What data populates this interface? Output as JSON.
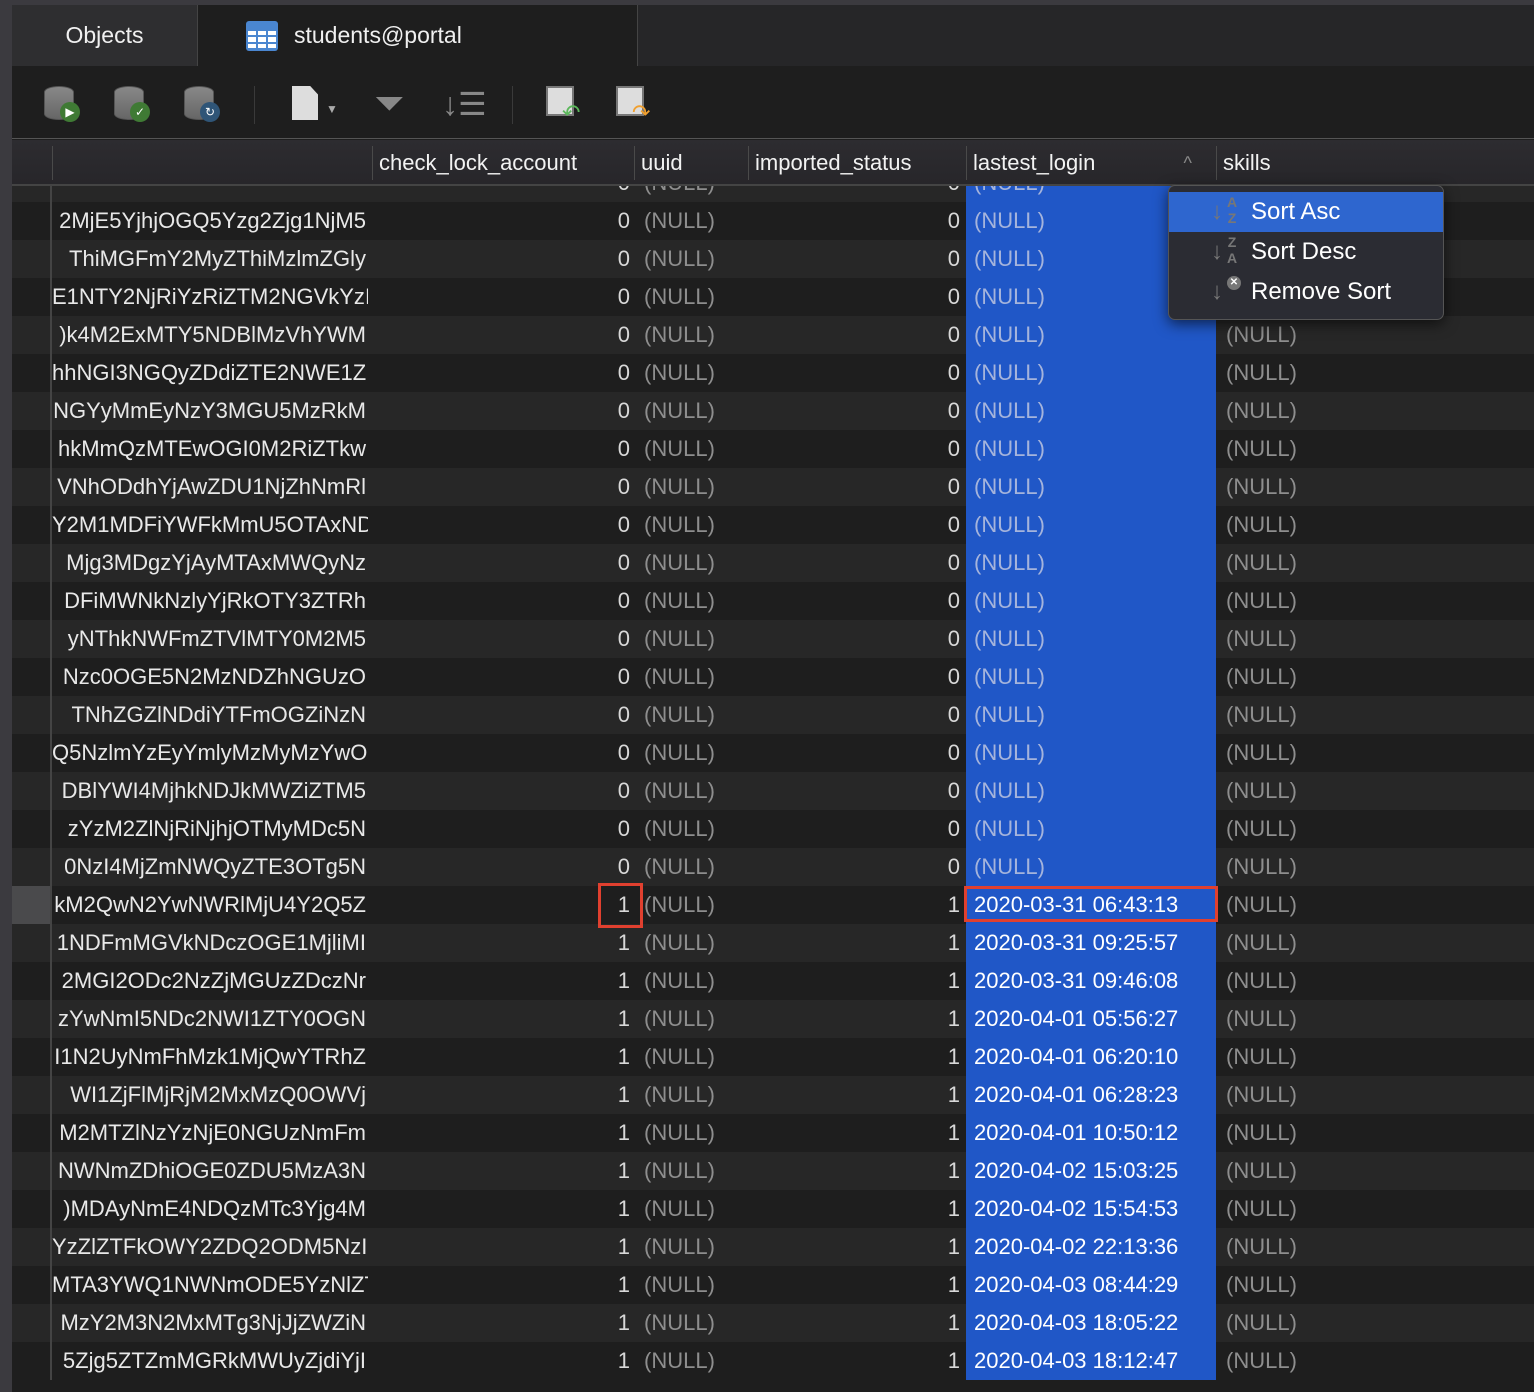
{
  "tabs": [
    {
      "label": "Objects"
    },
    {
      "label": "students@portal",
      "icon": "table-icon"
    }
  ],
  "toolbar": {
    "icons": [
      "db-run-icon",
      "db-commit-icon",
      "db-refresh-icon",
      "document-menu-icon",
      "filter-icon",
      "sort-icon",
      "import-icon",
      "export-icon"
    ]
  },
  "columns": {
    "check_lock_account": "check_lock_account",
    "uuid": "uuid",
    "imported_status": "imported_status",
    "lastest_login": "lastest_login",
    "skills": "skills"
  },
  "context_menu": {
    "items": [
      {
        "label": "Sort Asc",
        "icon": "sort-asc-icon",
        "active": true
      },
      {
        "label": "Sort Desc",
        "icon": "sort-desc-icon"
      },
      {
        "label": "Remove Sort",
        "icon": "remove-sort-icon"
      }
    ]
  },
  "colors": {
    "selected_column": "#2057c7",
    "highlight_box": "#e0402f",
    "menu_active": "#2e66cf"
  },
  "rows": [
    {
      "id": "",
      "lock": "0",
      "uuid": "(NULL)",
      "imp": "0",
      "login": "(NULL)",
      "skills": ""
    },
    {
      "id": "2MjE5YjhjOGQ5Yzg2Zjg1NjM5",
      "lock": "0",
      "uuid": "(NULL)",
      "imp": "0",
      "login": "(NULL)",
      "skills": ""
    },
    {
      "id": "ThiMGFmY2MyZThiMzlmZGly",
      "lock": "0",
      "uuid": "(NULL)",
      "imp": "0",
      "login": "(NULL)",
      "skills": ""
    },
    {
      "id": "E1NTY2NjRiYzRiZTM2NGVkYzI",
      "lock": "0",
      "uuid": "(NULL)",
      "imp": "0",
      "login": "(NULL)",
      "skills": ""
    },
    {
      "id": ")k4M2ExMTY5NDBlMzVhYWM",
      "lock": "0",
      "uuid": "(NULL)",
      "imp": "0",
      "login": "(NULL)",
      "skills": "(NULL)"
    },
    {
      "id": "hhNGI3NGQyZDdiZTE2NWE1Z",
      "lock": "0",
      "uuid": "(NULL)",
      "imp": "0",
      "login": "(NULL)",
      "skills": "(NULL)"
    },
    {
      "id": "NGYyMmEyNzY3MGU5MzRkM",
      "lock": "0",
      "uuid": "(NULL)",
      "imp": "0",
      "login": "(NULL)",
      "skills": "(NULL)"
    },
    {
      "id": "hkMmQzMTEwOGI0M2RiZTkw",
      "lock": "0",
      "uuid": "(NULL)",
      "imp": "0",
      "login": "(NULL)",
      "skills": "(NULL)"
    },
    {
      "id": "VNhODdhYjAwZDU1NjZhNmRl",
      "lock": "0",
      "uuid": "(NULL)",
      "imp": "0",
      "login": "(NULL)",
      "skills": "(NULL)"
    },
    {
      "id": "Y2M1MDFiYWFkMmU5OTAxND",
      "lock": "0",
      "uuid": "(NULL)",
      "imp": "0",
      "login": "(NULL)",
      "skills": "(NULL)"
    },
    {
      "id": "Mjg3MDgzYjAyMTAxMWQyNz",
      "lock": "0",
      "uuid": "(NULL)",
      "imp": "0",
      "login": "(NULL)",
      "skills": "(NULL)"
    },
    {
      "id": "DFiMWNkNzlyYjRkOTY3ZTRh",
      "lock": "0",
      "uuid": "(NULL)",
      "imp": "0",
      "login": "(NULL)",
      "skills": "(NULL)"
    },
    {
      "id": "yNThkNWFmZTVlMTY0M2M5",
      "lock": "0",
      "uuid": "(NULL)",
      "imp": "0",
      "login": "(NULL)",
      "skills": "(NULL)"
    },
    {
      "id": "Nzc0OGE5N2MzNDZhNGUzO",
      "lock": "0",
      "uuid": "(NULL)",
      "imp": "0",
      "login": "(NULL)",
      "skills": "(NULL)"
    },
    {
      "id": "TNhZGZlNDdiYTFmOGZiNzN",
      "lock": "0",
      "uuid": "(NULL)",
      "imp": "0",
      "login": "(NULL)",
      "skills": "(NULL)"
    },
    {
      "id": "Q5NzlmYzEyYmlyMzMyMzYwO",
      "lock": "0",
      "uuid": "(NULL)",
      "imp": "0",
      "login": "(NULL)",
      "skills": "(NULL)"
    },
    {
      "id": "DBlYWI4MjhkNDJkMWZiZTM5",
      "lock": "0",
      "uuid": "(NULL)",
      "imp": "0",
      "login": "(NULL)",
      "skills": "(NULL)"
    },
    {
      "id": "zYzM2ZlNjRiNjhjOTMyMDc5N",
      "lock": "0",
      "uuid": "(NULL)",
      "imp": "0",
      "login": "(NULL)",
      "skills": "(NULL)"
    },
    {
      "id": "0NzI4MjZmNWQyZTE3OTg5N",
      "lock": "0",
      "uuid": "(NULL)",
      "imp": "0",
      "login": "(NULL)",
      "skills": "(NULL)"
    },
    {
      "id": "kM2QwN2YwNWRlMjU4Y2Q5Z",
      "lock": "1",
      "uuid": "(NULL)",
      "imp": "1",
      "login": "2020-03-31 06:43:13",
      "skills": "(NULL)",
      "selected": true
    },
    {
      "id": "1NDFmMGVkNDczOGE1MjliMI",
      "lock": "1",
      "uuid": "(NULL)",
      "imp": "1",
      "login": "2020-03-31 09:25:57",
      "skills": "(NULL)"
    },
    {
      "id": "2MGI2ODc2NzZjMGUzZDczNr",
      "lock": "1",
      "uuid": "(NULL)",
      "imp": "1",
      "login": "2020-03-31 09:46:08",
      "skills": "(NULL)"
    },
    {
      "id": "zYwNmI5NDc2NWI1ZTY0OGN",
      "lock": "1",
      "uuid": "(NULL)",
      "imp": "1",
      "login": "2020-04-01 05:56:27",
      "skills": "(NULL)"
    },
    {
      "id": "I1N2UyNmFhMzk1MjQwYTRhZ",
      "lock": "1",
      "uuid": "(NULL)",
      "imp": "1",
      "login": "2020-04-01 06:20:10",
      "skills": "(NULL)"
    },
    {
      "id": "WI1ZjFlMjRjM2MxMzQ0OWVj",
      "lock": "1",
      "uuid": "(NULL)",
      "imp": "1",
      "login": "2020-04-01 06:28:23",
      "skills": "(NULL)"
    },
    {
      "id": "M2MTZlNzYzNjE0NGUzNmFm",
      "lock": "1",
      "uuid": "(NULL)",
      "imp": "1",
      "login": "2020-04-01 10:50:12",
      "skills": "(NULL)"
    },
    {
      "id": "NWNmZDhiOGE0ZDU5MzA3N",
      "lock": "1",
      "uuid": "(NULL)",
      "imp": "1",
      "login": "2020-04-02 15:03:25",
      "skills": "(NULL)"
    },
    {
      "id": ")MDAyNmE4NDQzMTc3Yjg4M",
      "lock": "1",
      "uuid": "(NULL)",
      "imp": "1",
      "login": "2020-04-02 15:54:53",
      "skills": "(NULL)"
    },
    {
      "id": "YzZlZTFkOWY2ZDQ2ODM5NzI",
      "lock": "1",
      "uuid": "(NULL)",
      "imp": "1",
      "login": "2020-04-02 22:13:36",
      "skills": "(NULL)"
    },
    {
      "id": "MTA3YWQ1NWNmODE5YzNlZT",
      "lock": "1",
      "uuid": "(NULL)",
      "imp": "1",
      "login": "2020-04-03 08:44:29",
      "skills": "(NULL)"
    },
    {
      "id": "MzY2M3N2MxMTg3NjJjZWZiN",
      "lock": "1",
      "uuid": "(NULL)",
      "imp": "1",
      "login": "2020-04-03 18:05:22",
      "skills": "(NULL)"
    },
    {
      "id": "5Zjg5ZTZmMGRkMWUyZjdiYjI",
      "lock": "1",
      "uuid": "(NULL)",
      "imp": "1",
      "login": "2020-04-03 18:12:47",
      "skills": "(NULL)"
    }
  ]
}
